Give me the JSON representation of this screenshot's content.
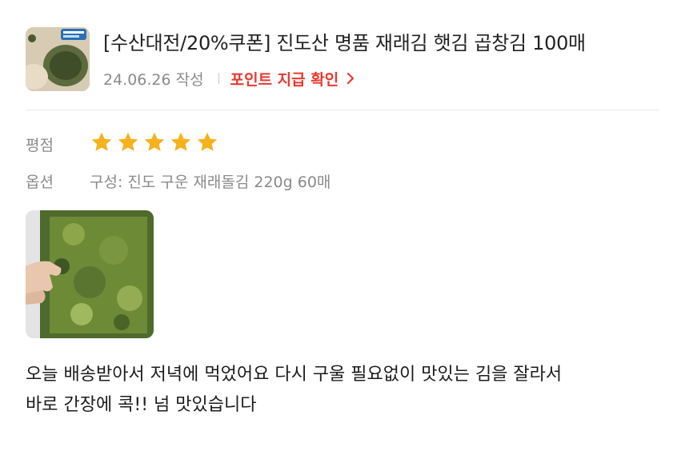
{
  "product": {
    "title": "[수산대전/20%쿠폰] 진도산 명품 재래김 햇김 곱창김 100매",
    "thumbnail_icon": "product-thumbnail-image"
  },
  "meta": {
    "date": "24.06.26 작성",
    "point_link_label": "포인트 지급 확인",
    "point_link_color": "#e8392f"
  },
  "rating": {
    "label": "평점",
    "stars": 5,
    "max_stars": 5,
    "star_color": "#f5b21c"
  },
  "option": {
    "label": "옵션",
    "value": "구성: 진도 구운 재래돌김 220g 60매"
  },
  "review": {
    "photo_icon": "review-photo-image",
    "text_lines": [
      "오늘 배송받아서 저녁에 먹었어요 다시 구울 필요없이 맛있는 김을 잘라서",
      "바로 간장에 콕!! 넘 맛있습니다"
    ]
  }
}
